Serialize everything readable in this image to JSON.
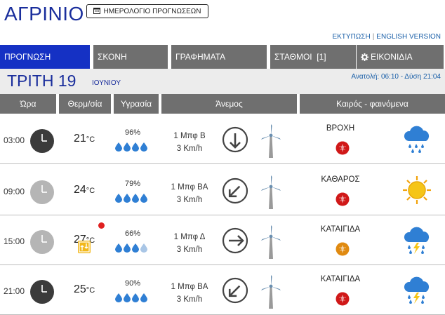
{
  "header": {
    "city": "ΑΓΡΙΝΙΟ",
    "calendar_button": "ΗΜΕΡΟΛΟΓΙΟ ΠΡΟΓΝΩΣΕΩΝ",
    "print_link": "ΕΚΤΥΠΩΣΗ",
    "separator": "|",
    "english_link": "ENGLISH VERSION"
  },
  "tabs": [
    {
      "label": "ΠΡΟΓΝΩΣΗ"
    },
    {
      "label": "ΣΚΟΝΗ"
    },
    {
      "label": "ΓΡΑΦΗΜΑΤΑ"
    },
    {
      "label": "ΣΤΑΘΜΟΙ  [1]"
    },
    {
      "label": "ΕΙΚΟΝΙΔΙΑ"
    }
  ],
  "day": {
    "name": "ΤΡΙΤΗ 19",
    "month": "ΙΟΥΝΙΟΥ",
    "sun": "Ανατολή: 06:10 - Δύση 21:04"
  },
  "columns": [
    "Ώρα",
    "Θερμ/σία",
    "Υγρασία",
    "Άνεμος",
    "Καιρός - φαινόμενα"
  ],
  "rows": [
    {
      "time": "03:00",
      "temp": "21",
      "unit": "°C",
      "humidity": "96%",
      "drops": 4,
      "wind_bf": "1 Μπφ Β",
      "wind_kmh": "3 Km/h",
      "wind_dir": "B",
      "weather": "ΒΡΟΧΗ",
      "icon": "rain-cloud-icon",
      "night": true,
      "pin_color": "#d01818",
      "red_dot": false,
      "warn": false
    },
    {
      "time": "09:00",
      "temp": "24",
      "unit": "°C",
      "humidity": "79%",
      "drops": 4,
      "wind_bf": "1 Μπφ ΒΑ",
      "wind_kmh": "3 Km/h",
      "wind_dir": "BA",
      "weather": "ΚΑΘΑΡΟΣ",
      "icon": "sun-icon",
      "night": false,
      "pin_color": "#d01818",
      "red_dot": false,
      "warn": false
    },
    {
      "time": "15:00",
      "temp": "27",
      "unit": "°C",
      "humidity": "66%",
      "drops": 3,
      "wind_bf": "1 Μπφ Δ",
      "wind_kmh": "3 Km/h",
      "wind_dir": "Δ",
      "weather": "ΚΑΤΑΙΓΙΔΑ",
      "icon": "thunderstorm-icon",
      "night": false,
      "pin_color": "#e08a10",
      "red_dot": true,
      "warn": true
    },
    {
      "time": "21:00",
      "temp": "25",
      "unit": "°C",
      "humidity": "90%",
      "drops": 4,
      "wind_bf": "1 Μπφ ΒΑ",
      "wind_kmh": "3 Km/h",
      "wind_dir": "BA",
      "weather": "ΚΑΤΑΙΓΙΔΑ",
      "icon": "thunderstorm-icon",
      "night": true,
      "pin_color": "#d01818",
      "red_dot": false,
      "warn": false
    }
  ],
  "colors": {
    "accent": "#1531c4",
    "tab_gray": "#6f6f6f",
    "drop": "#2f7fd4",
    "cloud": "#2f7fd4",
    "sun": "#f5c518"
  }
}
